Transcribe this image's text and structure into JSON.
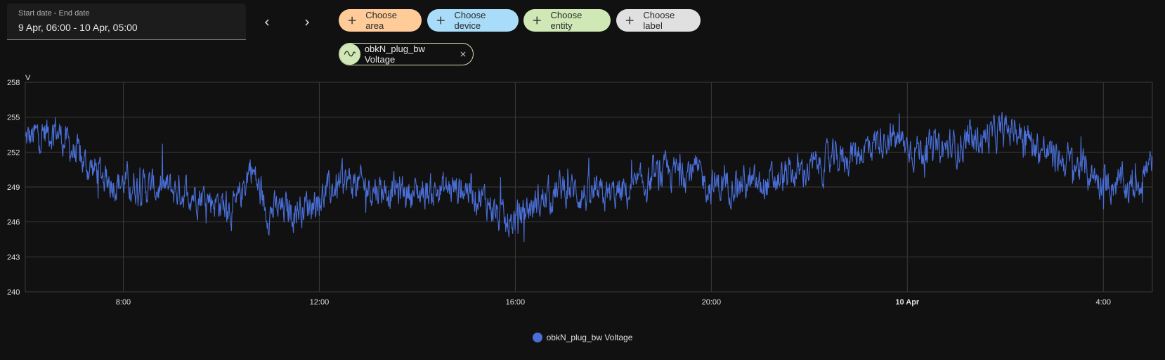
{
  "date_range": {
    "label": "Start date - End date",
    "value": "9 Apr, 06:00 - 10 Apr, 05:00"
  },
  "nav": {
    "prev_icon": "chevron-left-icon",
    "next_icon": "chevron-right-icon"
  },
  "target_chips": [
    {
      "label": "Choose area",
      "color": "#ffcc99"
    },
    {
      "label": "Choose device",
      "color": "#a8dcf8"
    },
    {
      "label": "Choose entity",
      "color": "#cfe8b5"
    },
    {
      "label": "Choose label",
      "color": "#e0e0e0"
    }
  ],
  "selected_entity": {
    "label": "obkN_plug_bw Voltage",
    "icon": "sine-wave-icon",
    "icon_color": "#cfe8b5"
  },
  "chart_data": {
    "type": "line",
    "ylabel": "V",
    "ylim": [
      240,
      258
    ],
    "yticks": [
      240,
      243,
      246,
      249,
      252,
      255,
      258
    ],
    "x_range": [
      "9 Apr 06:00",
      "10 Apr 05:00"
    ],
    "xticks": [
      {
        "label": "8:00",
        "hour": 8,
        "bold": false
      },
      {
        "label": "12:00",
        "hour": 12,
        "bold": false
      },
      {
        "label": "16:00",
        "hour": 16,
        "bold": false
      },
      {
        "label": "20:00",
        "hour": 20,
        "bold": false
      },
      {
        "label": "10 Apr",
        "hour": 24,
        "bold": true
      },
      {
        "label": "4:00",
        "hour": 28,
        "bold": false
      }
    ],
    "grid": true,
    "series": [
      {
        "name": "obkN_plug_bw Voltage",
        "color": "#4a6fd8",
        "x_hours_start": 6,
        "x_hours_end": 29,
        "trend": [
          [
            6,
            253
          ],
          [
            6.6,
            254
          ],
          [
            7.2,
            251
          ],
          [
            7.8,
            249.5
          ],
          [
            8.5,
            249
          ],
          [
            9.5,
            248.5
          ],
          [
            10.3,
            247
          ],
          [
            10.6,
            251
          ],
          [
            10.9,
            247
          ],
          [
            11.5,
            247
          ],
          [
            12.0,
            248
          ],
          [
            12.5,
            249.5
          ],
          [
            13.0,
            249
          ],
          [
            14.0,
            248.5
          ],
          [
            15.0,
            249
          ],
          [
            15.5,
            247.5
          ],
          [
            15.8,
            245.5
          ],
          [
            16.2,
            247
          ],
          [
            17.0,
            249
          ],
          [
            17.6,
            248
          ],
          [
            18.3,
            248.5
          ],
          [
            19.0,
            250
          ],
          [
            19.6,
            250.5
          ],
          [
            20.0,
            249
          ],
          [
            20.5,
            249.5
          ],
          [
            21.0,
            249
          ],
          [
            21.6,
            250
          ],
          [
            22.3,
            251
          ],
          [
            23.0,
            252
          ],
          [
            23.6,
            253.5
          ],
          [
            24.0,
            252.5
          ],
          [
            24.6,
            252
          ],
          [
            25.4,
            253
          ],
          [
            26.2,
            254
          ],
          [
            26.8,
            252
          ],
          [
            27.4,
            251
          ],
          [
            28.0,
            249.5
          ],
          [
            28.6,
            249
          ],
          [
            29.0,
            251
          ]
        ],
        "noise_amplitude": 1.6
      }
    ],
    "legend": "bottom-center"
  }
}
